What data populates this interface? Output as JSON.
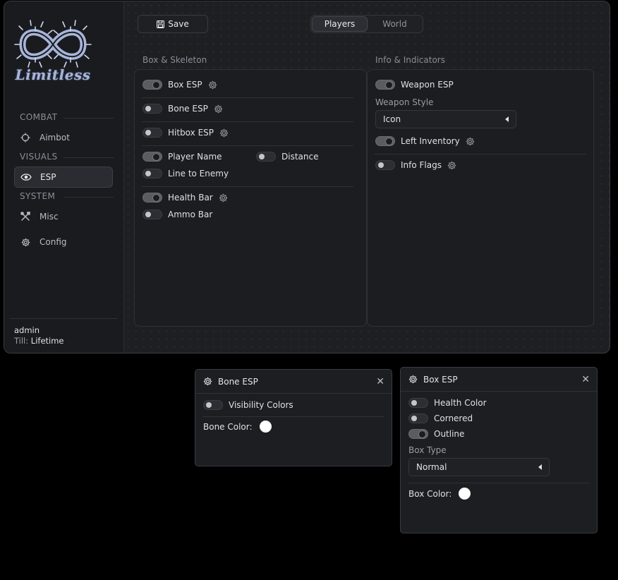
{
  "sidebar": {
    "logo_text": "Limitless",
    "sections": {
      "combat": "COMBAT",
      "visuals": "VISUALS",
      "system": "SYSTEM"
    },
    "items": {
      "aimbot": "Aimbot",
      "esp": "ESP",
      "misc": "Misc",
      "config": "Config"
    },
    "user": {
      "name": "admin",
      "till_label": "Till:",
      "till_value": "Lifetime"
    }
  },
  "toolbar": {
    "save_label": "Save",
    "tabs": [
      "Players",
      "World"
    ],
    "active_tab": "Players"
  },
  "left_panel": {
    "title": "Box & Skeleton",
    "rows": {
      "box_esp": {
        "label": "Box ESP",
        "on": true
      },
      "bone_esp": {
        "label": "Bone ESP",
        "on": false
      },
      "hitbox_esp": {
        "label": "Hitbox ESP",
        "on": false
      },
      "player_name": {
        "label": "Player Name",
        "on": true
      },
      "distance": {
        "label": "Distance",
        "on": false
      },
      "line_to_enemy": {
        "label": "Line to Enemy",
        "on": false
      },
      "health_bar": {
        "label": "Health Bar",
        "on": true
      },
      "ammo_bar": {
        "label": "Ammo Bar",
        "on": false
      }
    }
  },
  "right_panel": {
    "title": "Info & Indicators",
    "weapon_esp": {
      "label": "Weapon ESP",
      "on": true
    },
    "weapon_style_label": "Weapon Style",
    "weapon_style_value": "Icon",
    "left_inventory": {
      "label": "Left Inventory",
      "on": true
    },
    "info_flags": {
      "label": "Info Flags",
      "on": false
    }
  },
  "bone_popup": {
    "title": "Bone ESP",
    "visibility_colors": {
      "label": "Visibility Colors",
      "on": false
    },
    "bone_color_label": "Bone Color:",
    "bone_color": "#ffffff"
  },
  "box_popup": {
    "title": "Box ESP",
    "health_color": {
      "label": "Health Color",
      "on": false
    },
    "cornered": {
      "label": "Cornered",
      "on": false
    },
    "outline": {
      "label": "Outline",
      "on": true
    },
    "box_type_label": "Box Type",
    "box_type_value": "Normal",
    "box_color_label": "Box Color:",
    "box_color": "#ffffff"
  },
  "colors": {
    "logo": "#a7b5d9",
    "background": "#1d1e22",
    "accent": "#5a5c62"
  },
  "icons": {
    "aimbot": "crosshair-icon",
    "esp": "eye-icon",
    "misc": "tools-icon",
    "config": "gear-icon",
    "save": "floppy-icon",
    "close": "close-icon"
  }
}
